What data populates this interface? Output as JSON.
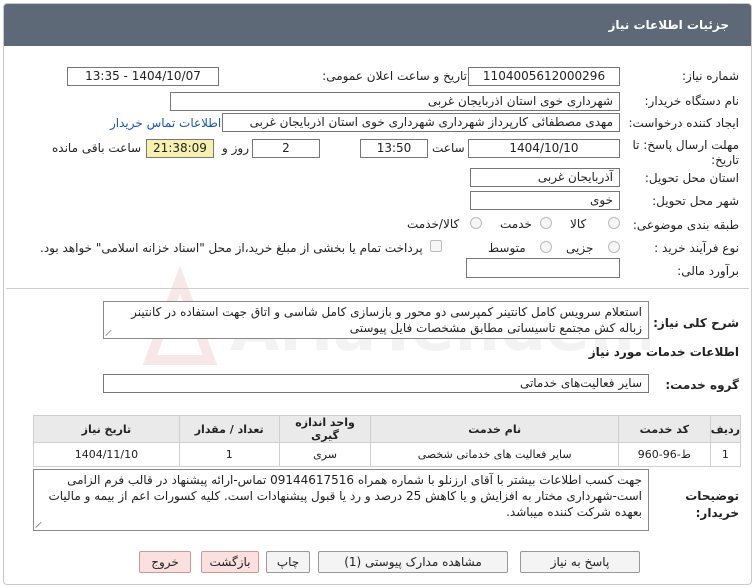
{
  "header": {
    "title": "جزئیات اطلاعات نیاز"
  },
  "fields": {
    "need_number_label": "شماره نیاز:",
    "need_number": "1104005612000296",
    "announce_label": "تاریخ و ساعت اعلان عمومی:",
    "announce_value": "1404/10/07 - 13:35",
    "buyer_org_label": "نام دستگاه خریدار:",
    "buyer_org": "شهرداری خوی استان اذربایجان غربی",
    "creator_label": "ایجاد کننده درخواست:",
    "creator": "مهدی مصطفائی کارپرداز شهرداری شهرداری خوی استان اذربایجان غربی",
    "contact_link": "اطلاعات تماس خریدار",
    "deadline_label": "مهلت ارسال پاسخ: تا تاریخ:",
    "deadline_date": "1404/10/10",
    "time_label": "ساعت",
    "deadline_time": "13:50",
    "days_value": "2",
    "days_label": "روز و",
    "remaining_time": "21:38:09",
    "remaining_label": "ساعت باقی مانده",
    "province_label": "استان محل تحویل:",
    "province": "آذربایجان غربی",
    "city_label": "شهر محل تحویل:",
    "city": "خوی",
    "category_label": "طبقه بندی موضوعی:",
    "category_options": [
      "کالا",
      "خدمت",
      "کالا/خدمت"
    ],
    "process_label": "نوع فرآیند خرید :",
    "process_options": [
      "جزیی",
      "متوسط"
    ],
    "payment_note": "پرداخت تمام یا بخشی از مبلغ خرید،از محل \"اسناد خزانه اسلامی\" خواهد بود.",
    "budget_label": "برآورد مالی:",
    "budget_value": ""
  },
  "summary": {
    "label": "شرح کلی نیاز:",
    "text": "استعلام سرویس کامل کانتینر کمپرسی دو محور و بازسازی کامل شاسی و اتاق جهت استفاده در کانتینر زباله کش مجتمع تاسیساتی مطابق مشخصات فایل پیوستی"
  },
  "services": {
    "section_title": "اطلاعات خدمات مورد نیاز",
    "group_label": "گروه خدمت:",
    "group_value": "سایر فعالیت‌های خدماتی",
    "columns": [
      "ردیف",
      "کد خدمت",
      "نام خدمت",
      "واحد اندازه گیری",
      "تعداد / مقدار",
      "تاریخ نیاز"
    ],
    "rows": [
      [
        "1",
        "ط-96-960",
        "سایر فعالیت های خدماتی شخصی",
        "سری",
        "1",
        "1404/11/10"
      ]
    ]
  },
  "buyer_notes": {
    "label": "توضیحات خریدار:",
    "text": "جهت کسب اطلاعات بیشتر با آقای ارزنلو با شماره همراه 09144617516 تماس-ارائه پیشنهاد در قالب فرم الزامی است-شهرداری مختار به افزایش و یا کاهش 25 درصد و رد یا قبول پیشنهادات است. کلیه کسورات اعم از بیمه و مالیات بعهده شرکت کننده میباشد."
  },
  "buttons": {
    "reply": "پاسخ به نیاز",
    "view_docs": "مشاهده مدارک پیوستی (1)",
    "print": "چاپ",
    "back": "بازگشت",
    "exit": "خروج"
  },
  "watermark": {
    "text": "AriaTender.net"
  }
}
